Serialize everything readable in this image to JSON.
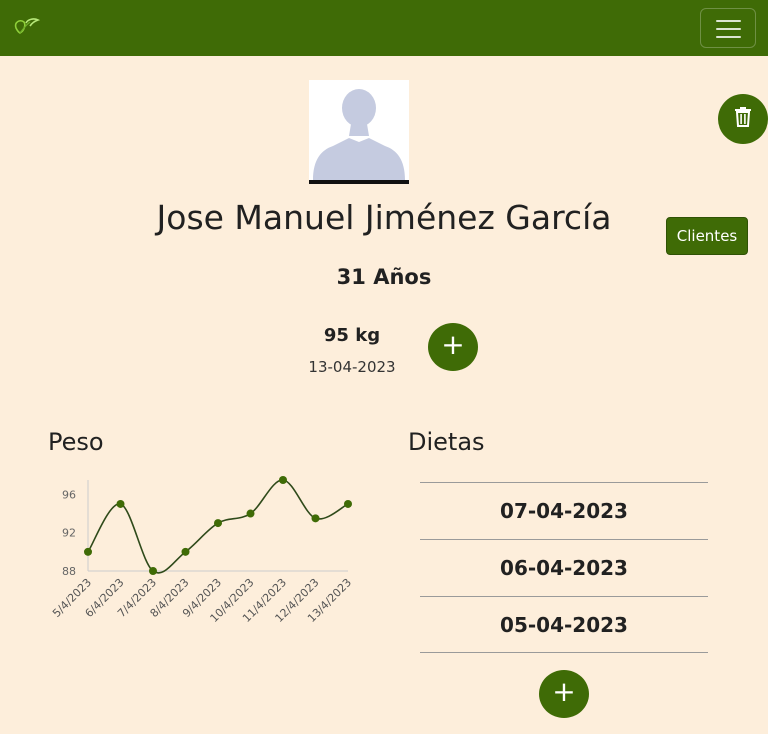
{
  "navbar": {
    "logo_icon": "leaf-logo-icon",
    "menu_icon": "hamburger-menu-icon",
    "color": "#3f6b06"
  },
  "profile": {
    "avatar_icon": "user-avatar-placeholder",
    "name": "Jose Manuel Jiménez García",
    "age": "31 Años",
    "weight": "95 kg",
    "weight_date": "13-04-2023"
  },
  "actions": {
    "delete_icon": "trash-icon",
    "clients_label": "Clientes",
    "add_icon": "+"
  },
  "peso": {
    "title": "Peso"
  },
  "dietas": {
    "title": "Dietas",
    "items": [
      "07-04-2023",
      "06-04-2023",
      "05-04-2023"
    ]
  },
  "chart_data": {
    "type": "line",
    "title": "",
    "xlabel": "",
    "ylabel": "",
    "categories": [
      "5/4/2023",
      "6/4/2023",
      "7/4/2023",
      "8/4/2023",
      "9/4/2023",
      "10/4/2023",
      "11/4/2023",
      "12/4/2023",
      "13/4/2023"
    ],
    "series": [
      {
        "values": [
          90,
          95,
          88,
          90,
          93,
          94,
          97.5,
          93.5,
          95
        ]
      }
    ],
    "yticks": [
      88,
      92,
      96
    ],
    "ylim": [
      88,
      97.5
    ],
    "grid": false,
    "line_color": "#2f4a1a",
    "point_color": "#3f6b06"
  }
}
